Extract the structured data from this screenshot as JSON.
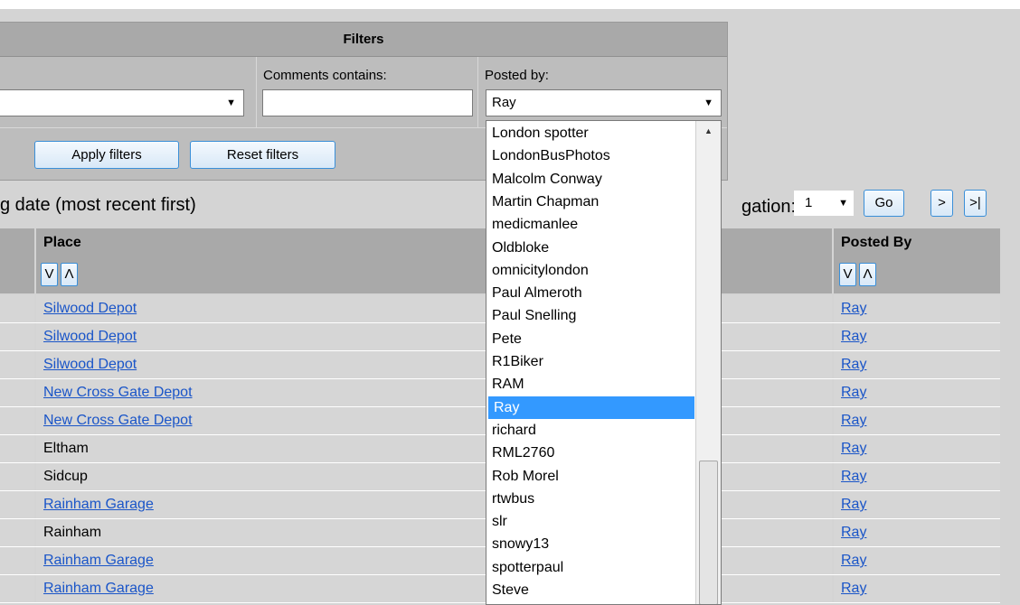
{
  "filters": {
    "title": "Filters",
    "comments_label": "Comments contains:",
    "comments_value": "",
    "posted_by_label": "Posted by:",
    "posted_by_value": "Ray",
    "apply_label": "Apply filters",
    "reset_label": "Reset filters"
  },
  "sort_text": "g date (most recent first)",
  "pagination": {
    "label": "gation:",
    "page_value": "1",
    "go_label": "Go",
    "next_label": ">",
    "last_label": ">|"
  },
  "table": {
    "headers": {
      "place": "Place",
      "posted_by": "Posted By"
    },
    "sort_down": "V",
    "sort_up": "Λ",
    "rows": [
      {
        "place": "Silwood Depot",
        "place_link": true,
        "posted_by": "Ray"
      },
      {
        "place": "Silwood Depot",
        "place_link": true,
        "posted_by": "Ray"
      },
      {
        "place": "Silwood Depot",
        "place_link": true,
        "posted_by": "Ray"
      },
      {
        "place": "New Cross Gate Depot",
        "place_link": true,
        "posted_by": "Ray"
      },
      {
        "place": "New Cross Gate Depot",
        "place_link": true,
        "posted_by": "Ray"
      },
      {
        "place": "Eltham",
        "place_link": false,
        "posted_by": "Ray"
      },
      {
        "place": "Sidcup",
        "place_link": false,
        "posted_by": "Ray"
      },
      {
        "place": "Rainham Garage",
        "place_link": true,
        "posted_by": "Ray"
      },
      {
        "place": "Rainham",
        "place_link": false,
        "posted_by": "Ray"
      },
      {
        "place": "Rainham Garage",
        "place_link": true,
        "posted_by": "Ray"
      },
      {
        "place": "Rainham Garage",
        "place_link": true,
        "posted_by": "Ray"
      }
    ]
  },
  "dropdown": {
    "selected": "Ray",
    "options": [
      "London spotter",
      "LondonBusPhotos",
      "Malcolm Conway",
      "Martin Chapman",
      "medicmanlee",
      "Oldbloke",
      "omnicitylondon",
      "Paul Almeroth",
      "Paul Snelling",
      "Pete",
      "R1Biker",
      "RAM",
      "Ray",
      "richard",
      "RML2760",
      "Rob Morel",
      "rtwbus",
      "slr",
      "snowy13",
      "spotterpaul",
      "Steve"
    ]
  },
  "colors": {
    "link": "#1a55c8",
    "selection": "#3399ff",
    "button_border": "#3a8fd8"
  },
  "icons": {
    "dropdown_arrow": "chevron-down-icon",
    "scroll_up": "scroll-up-arrow-icon"
  }
}
